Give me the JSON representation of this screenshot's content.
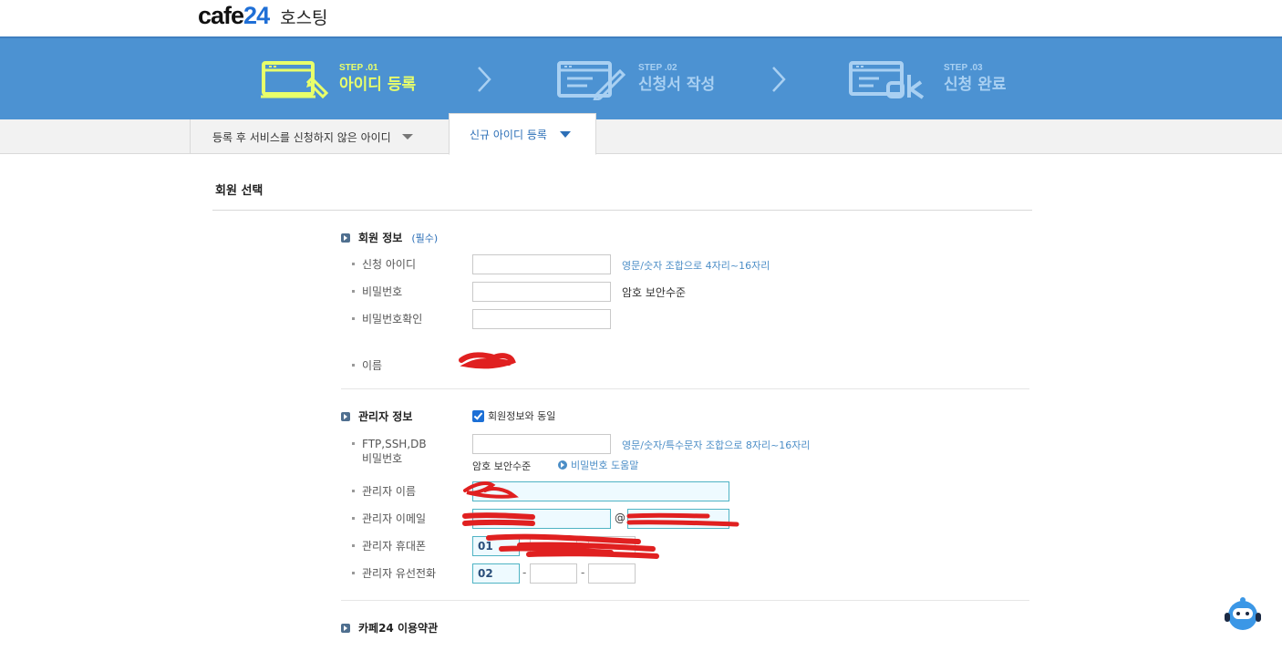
{
  "header": {
    "logo_cafe": "cafe",
    "logo_24": "24",
    "logo_sub": "호스팅",
    "brand_color": "#1f6fd6"
  },
  "steps": [
    {
      "num": "STEP .01",
      "title": "아이디 등록",
      "state": "active",
      "icon": "computer-pencil-icon"
    },
    {
      "num": "STEP .02",
      "title": "신청서 작성",
      "state": "inactive",
      "icon": "form-pencil-icon"
    },
    {
      "num": "STEP .03",
      "title": "신청 완료",
      "state": "inactive",
      "icon": "ok-icon"
    }
  ],
  "colors": {
    "banner": "#4c92d2",
    "active_step": "#e8ff6a",
    "inactive_step": "#a9d0f2",
    "link": "#4c8ec7"
  },
  "tabs": {
    "tab1_label": "등록 후 서비스를 신청하지 않은 아이디",
    "tab2_label": "신규 아이디 등록"
  },
  "section": {
    "title": "회원 선택"
  },
  "member": {
    "head": "회원 정보",
    "required": "(필수)",
    "id_label": "신청 아이디",
    "id_hint": "영문/숫자 조합으로 4자리~16자리",
    "pw_label": "비밀번호",
    "pw_strength": "암호 보안수준",
    "pw_confirm_label": "비밀번호확인",
    "name_label": "이름"
  },
  "admin": {
    "head": "관리자 정보",
    "same_checkbox": "회원정보와 동일",
    "same_checked": true,
    "ftp_label_1": "FTP,SSH,DB",
    "ftp_label_2": "비밀번호",
    "ftp_hint": "영문/숫자/특수문자 조합으로 8자리~16자리",
    "pw_strength": "암호 보안수준",
    "pw_help": "비밀번호 도움말",
    "name_label": "관리자 이름",
    "email_label": "관리자 이메일",
    "email_at": "@",
    "mobile_label": "관리자 휴대폰",
    "mobile_prefix": "01",
    "phone_label": "관리자 유선전화",
    "phone_area": "02",
    "dash": "-"
  },
  "terms": {
    "head": "카페24 이용약관"
  }
}
